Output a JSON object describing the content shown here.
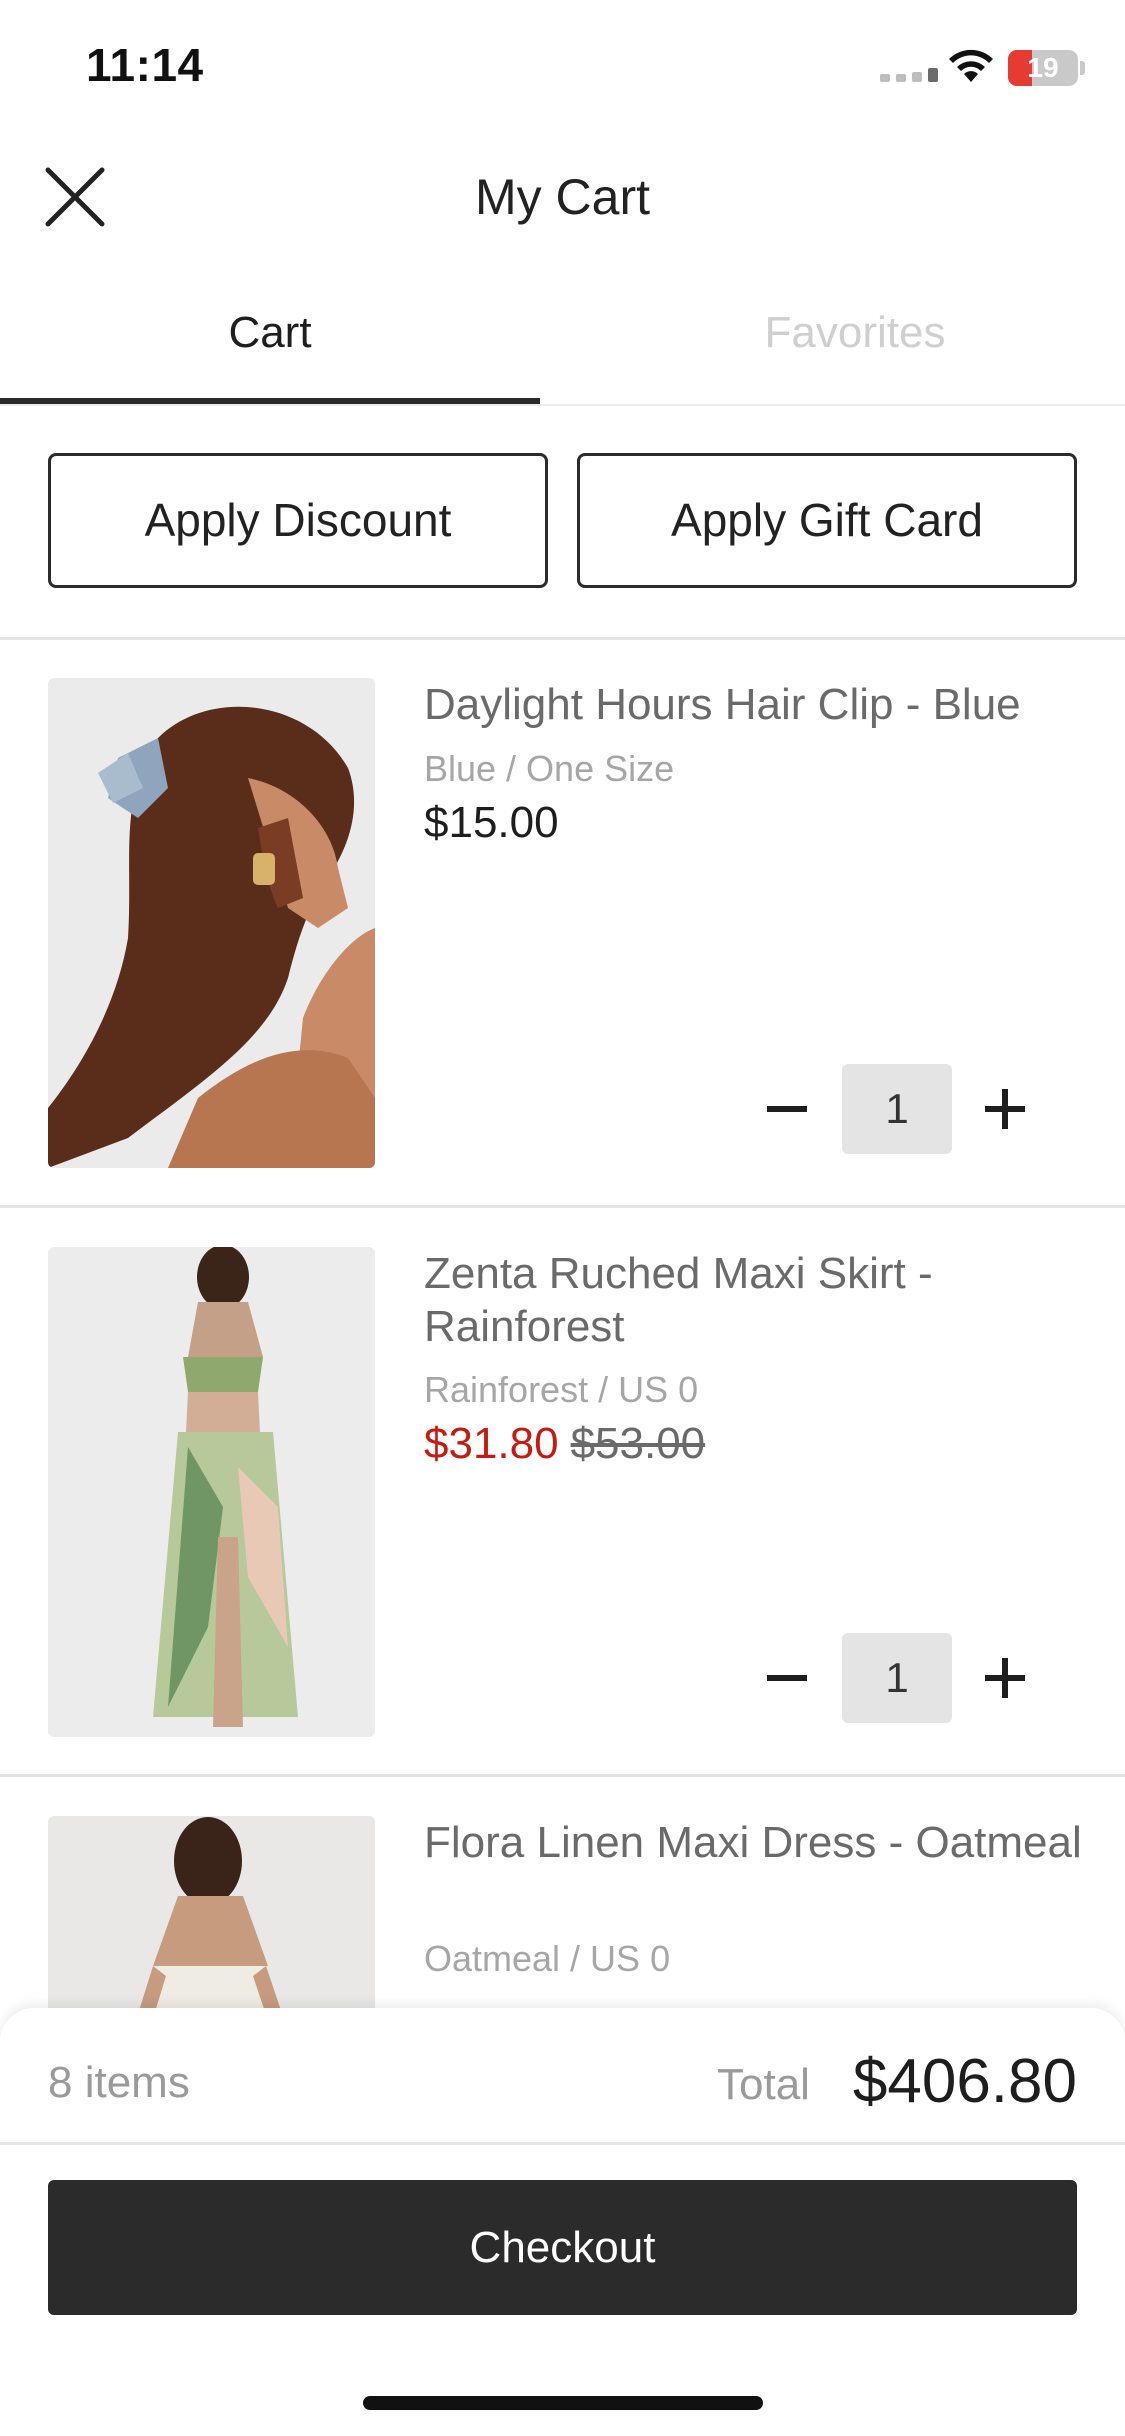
{
  "status_bar": {
    "time": "11:14",
    "battery": "19"
  },
  "header": {
    "title": "My Cart"
  },
  "tabs": [
    {
      "label": "Cart",
      "active": true
    },
    {
      "label": "Favorites",
      "active": false
    }
  ],
  "actions": {
    "discount_label": "Apply Discount",
    "gift_card_label": "Apply Gift Card"
  },
  "items": [
    {
      "name": "Daylight Hours Hair Clip - Blue",
      "variant": "Blue / One Size",
      "price": "$15.00",
      "quantity": "1",
      "image_icon": "product-photo"
    },
    {
      "name": "Zenta Ruched Maxi Skirt - Rainforest",
      "variant": "Rainforest / US 0",
      "price": "$31.80",
      "original_price": "$53.00",
      "quantity": "1",
      "image_icon": "product-photo"
    },
    {
      "name": "Flora Linen Maxi Dress - Oatmeal",
      "variant": "Oatmeal / US 0",
      "image_icon": "product-photo"
    }
  ],
  "summary": {
    "items_count": "8 items",
    "total_label": "Total",
    "total_value": "$406.80",
    "checkout_label": "Checkout"
  },
  "colors": {
    "accent": "#2b2b2b",
    "sale": "#c71b12",
    "inactive_tab": "#cfcfcf"
  }
}
